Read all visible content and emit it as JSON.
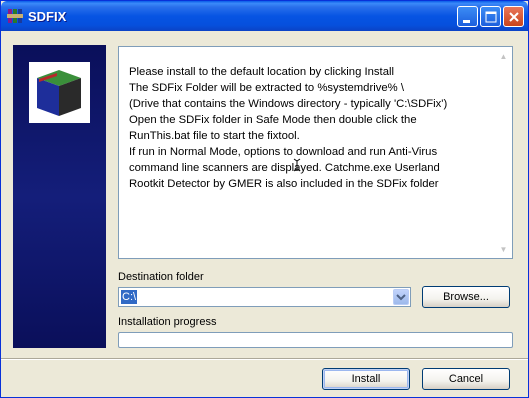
{
  "window": {
    "title": "SDFIX",
    "icon": "archive-icon"
  },
  "controls": {
    "minimize_icon": "minimize-icon",
    "maximize_icon": "maximize-icon",
    "close_icon": "close-icon"
  },
  "info": {
    "lines": [
      "Please install to the default location by clicking Install",
      "The SDFix Folder will be extracted to %systemdrive% \\",
      "(Drive that contains the Windows directory - typically 'C:\\SDFix')",
      "Open the SDFix folder in Safe Mode then double click the",
      "RunThis.bat file to start the fixtool.",
      "If run in Normal Mode, options to download and run Anti-Virus",
      "command line scanners are displayed. Catchme.exe Userland",
      "Rootkit Detector by GMER is also included in the SDFix folder"
    ]
  },
  "destination": {
    "label": "Destination folder",
    "value": "C:\\",
    "browse_label": "Browse..."
  },
  "progress": {
    "label": "Installation progress",
    "value": 0
  },
  "buttons": {
    "install": "Install",
    "cancel": "Cancel"
  },
  "colors": {
    "titlebar": "#0754E3",
    "panel": "#141E7A",
    "selection": "#316AC5"
  }
}
